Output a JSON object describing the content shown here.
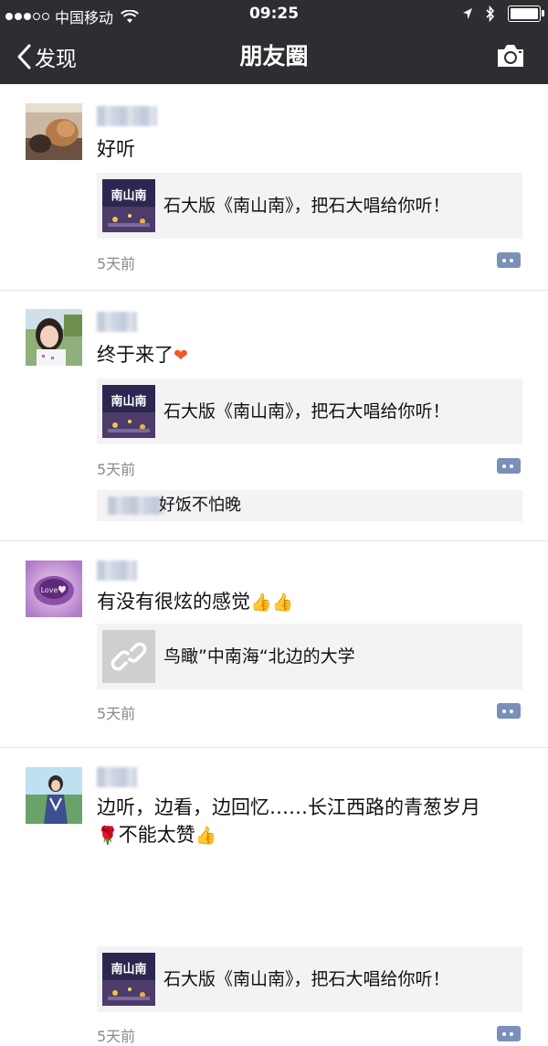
{
  "status_bar": {
    "carrier": "中国移动",
    "time": "09:25"
  },
  "nav": {
    "back_label": "发现",
    "title": "朋友圈"
  },
  "posts": [
    {
      "text": "好听",
      "link_title": "石大版《南山南》，把石大唱给你听！",
      "thumb_text": "南山南",
      "time": "5天前"
    },
    {
      "text": "终于来了",
      "emoji": "❤",
      "link_title": "石大版《南山南》，把石大唱给你听！",
      "thumb_text": "南山南",
      "time": "5天前",
      "comment": "好饭不怕晚"
    },
    {
      "text": "有没有很炫的感觉",
      "emoji": "👍👍",
      "avatar_text": "Love",
      "link_title": "鸟瞰”中南海“北边的大学",
      "time": "5天前"
    },
    {
      "text_line1": "边听，边看，边回忆……长江西路的青葱岁月",
      "text_line2": "不能太赞",
      "emoji_rose": "🌹",
      "emoji": "👍",
      "link_title": "石大版《南山南》，把石大唱给你听！",
      "thumb_text": "南山南",
      "time": "5天前"
    }
  ]
}
